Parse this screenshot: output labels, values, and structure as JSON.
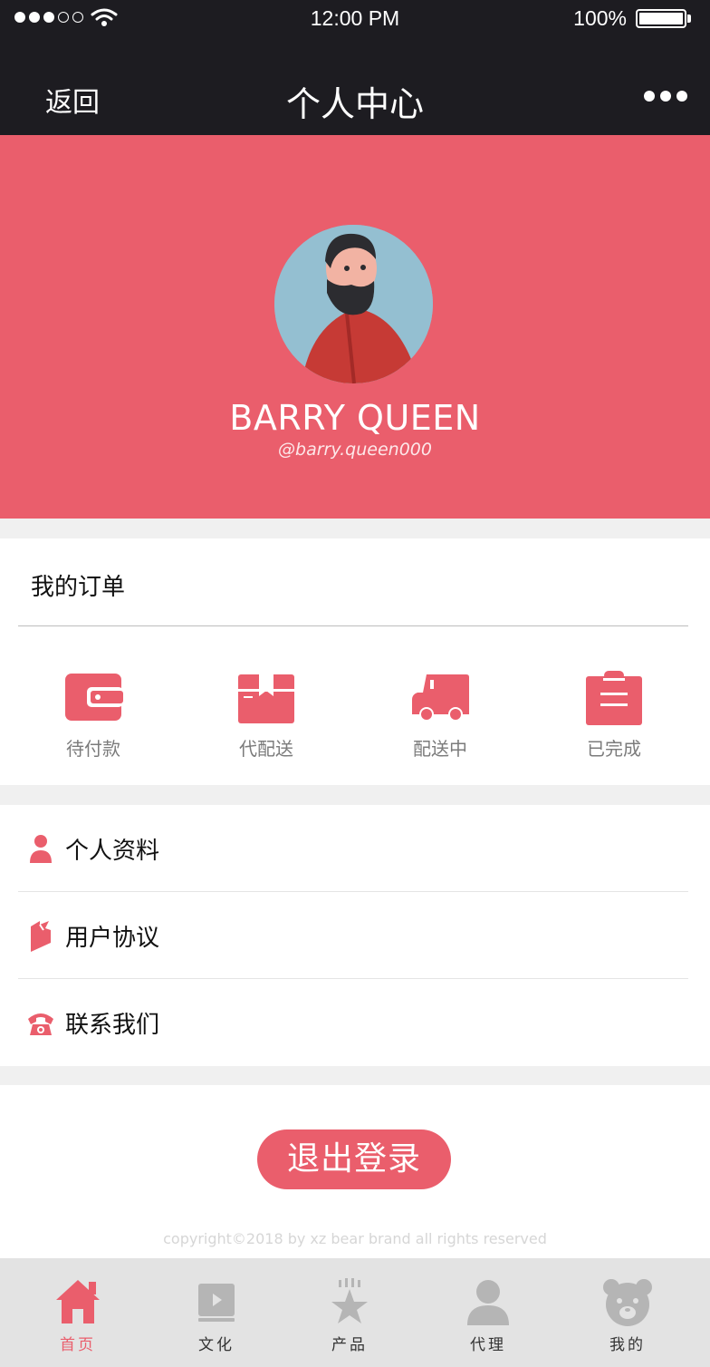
{
  "status_bar": {
    "time": "12:00 PM",
    "battery": "100%"
  },
  "nav": {
    "back": "返回",
    "title": "个人中心"
  },
  "profile": {
    "name": "BARRY QUEEN",
    "handle": "@barry.queen000"
  },
  "orders": {
    "title": "我的订单",
    "items": [
      {
        "label": "待付款",
        "icon": "wallet-icon"
      },
      {
        "label": "代配送",
        "icon": "package-icon"
      },
      {
        "label": "配送中",
        "icon": "delivery-truck-icon"
      },
      {
        "label": "已完成",
        "icon": "clipboard-icon"
      }
    ]
  },
  "menu": [
    {
      "label": "个人资料",
      "icon": "user-icon"
    },
    {
      "label": "用户协议",
      "icon": "book-icon"
    },
    {
      "label": "联系我们",
      "icon": "telephone-icon"
    }
  ],
  "logout": {
    "label": "退出登录"
  },
  "copyright": "copyright©2018 by xz bear brand all rights reserved",
  "tabs": [
    {
      "label": "首页",
      "icon": "home-icon",
      "active": true
    },
    {
      "label": "文化",
      "icon": "video-icon",
      "active": false
    },
    {
      "label": "产品",
      "icon": "star-icon",
      "active": false
    },
    {
      "label": "代理",
      "icon": "agent-icon",
      "active": false
    },
    {
      "label": "我的",
      "icon": "bear-icon",
      "active": false
    }
  ],
  "colors": {
    "accent": "#ea5e6c",
    "dark_bar": "#1d1c21",
    "inactive_icon": "#b5b5b5"
  }
}
